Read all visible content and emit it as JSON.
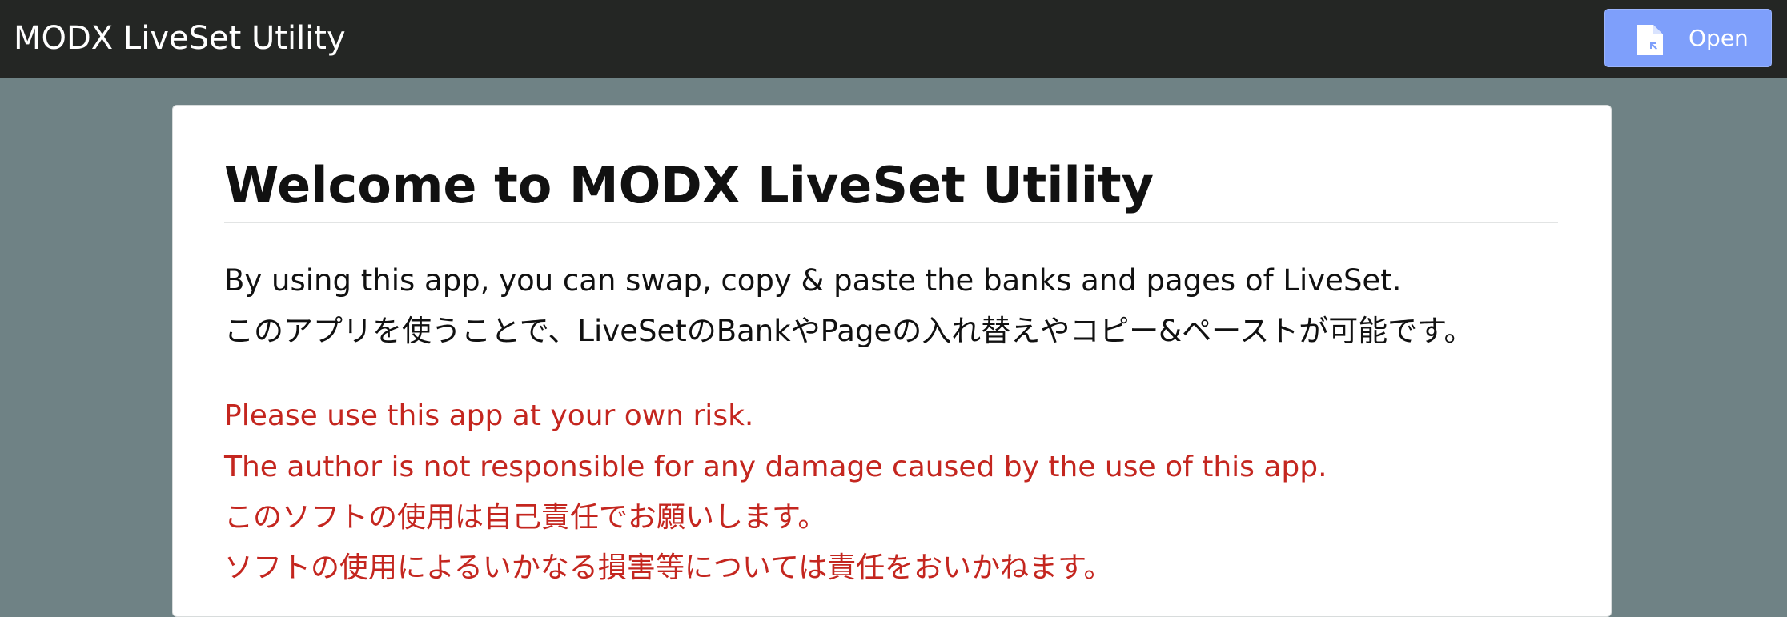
{
  "header": {
    "app_title": "MODX LiveSet Utility",
    "open_label": "Open",
    "open_icon": "file-open-icon"
  },
  "card": {
    "heading": "Welcome to MODX LiveSet Utility",
    "intro_en": "By using this app, you can swap, copy & paste the banks and pages of LiveSet.",
    "intro_ja": "このアプリを使うことで、LiveSetのBankやPageの入れ替えやコピー&ペーストが可能です。",
    "warnings": [
      "Please use this app at your own risk.",
      "The author is not responsible for any damage caused by the use of this app.",
      "このソフトの使用は自己責任でお願いします。",
      "ソフトの使用によるいかなる損害等については責任をおいかねます。"
    ]
  },
  "colors": {
    "topbar": "#242624",
    "background": "#6f8285",
    "button": "#7e9ffb",
    "warning_text": "#c4261f"
  }
}
